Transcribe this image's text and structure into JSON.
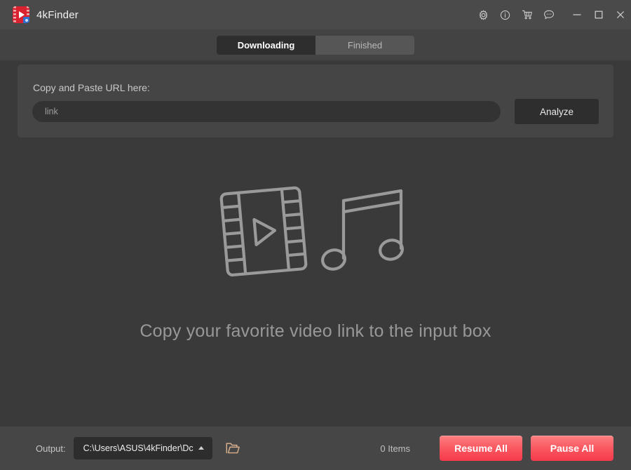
{
  "window": {
    "app_title": "4kFinder",
    "logo_icon": "film-play-logo-icon",
    "controls": [
      {
        "name": "settings-button",
        "icon": "gear-icon",
        "label": "Settings"
      },
      {
        "name": "info-button",
        "icon": "info-circle-icon",
        "label": "Info"
      },
      {
        "name": "store-button",
        "icon": "shopping-cart-icon",
        "label": "Store"
      },
      {
        "name": "feedback-button",
        "icon": "speech-bubble-icon",
        "label": "Feedback"
      },
      {
        "name": "minimize-button",
        "icon": "minimize-icon",
        "label": "Minimize"
      },
      {
        "name": "maximize-button",
        "icon": "maximize-icon",
        "label": "Maximize"
      },
      {
        "name": "close-button",
        "icon": "close-icon",
        "label": "Close"
      }
    ]
  },
  "tabs": {
    "downloading": "Downloading",
    "finished": "Finished",
    "active": "Downloading"
  },
  "url_panel": {
    "label": "Copy and Paste URL here:",
    "input_value": "",
    "input_placeholder": "link",
    "analyze_label": "Analyze"
  },
  "empty_state": {
    "message": "Copy your favorite video link to the input box",
    "art_icons": [
      "film-strip-icon",
      "music-note-icon"
    ]
  },
  "bottom_bar": {
    "output_label": "Output:",
    "output_path": "C:\\Users\\ASUS\\4kFinder\\Dc",
    "caret_icon": "chevron-up-icon",
    "folder_icon": "open-folder-icon",
    "items_count": "0 Items",
    "resume_label": "Resume All",
    "pause_label": "Pause All"
  },
  "colors": {
    "titlebar_bg": "#4a4a4a",
    "tabbar_bg": "#434343",
    "body_bg": "#3a3a3a",
    "panel_bg": "#454545",
    "bottombar_bg": "#464646",
    "accent_red": "#f6394b",
    "accent_red_light": "#fb8182",
    "logo_red": "#d8222f",
    "tab_active_bg": "#2e2e2e",
    "tab_inactive_bg": "#565656",
    "folder_icon_color": "#d6b08c"
  }
}
